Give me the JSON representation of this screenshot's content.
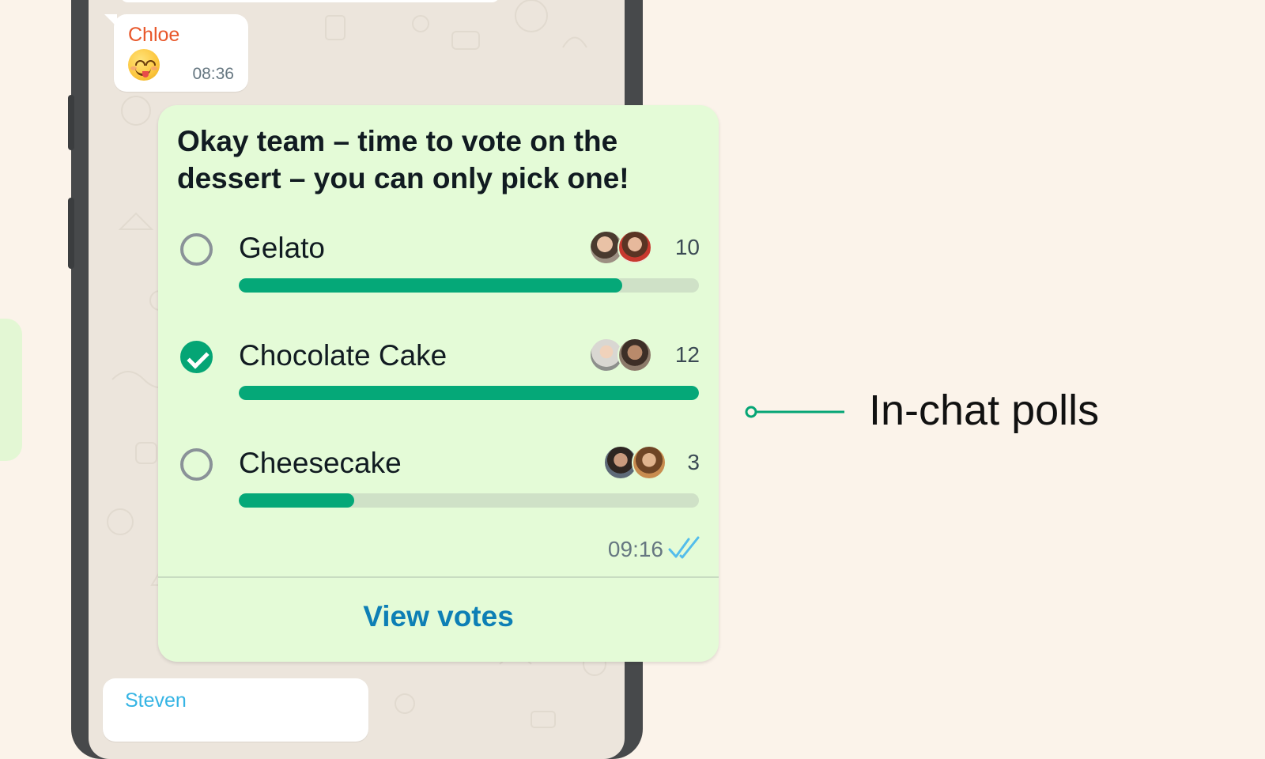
{
  "chat": {
    "messages": [
      {
        "sender": "Chloe",
        "sender_color": "#e8572a",
        "emoji": "smiling-face-with-tongue",
        "time": "08:36"
      }
    ],
    "next_sender": "Steven",
    "next_sender_color": "#35b4e4"
  },
  "poll": {
    "question": "Okay team – time to vote on the dessert – you can only pick one!",
    "options": [
      {
        "label": "Gelato",
        "votes": "10",
        "fraction": 0.833,
        "selected": false
      },
      {
        "label": "Chocolate Cake",
        "votes": "12",
        "fraction": 1.0,
        "selected": true
      },
      {
        "label": "Cheesecake",
        "votes": "3",
        "fraction": 0.25,
        "selected": false
      }
    ],
    "time": "09:16",
    "read_status": "double-check-read",
    "view_votes_label": "View votes",
    "accent_color": "#05a878",
    "link_color": "#0d7fb5"
  },
  "annotation": {
    "label": "In-chat polls",
    "color": "#05a575"
  }
}
